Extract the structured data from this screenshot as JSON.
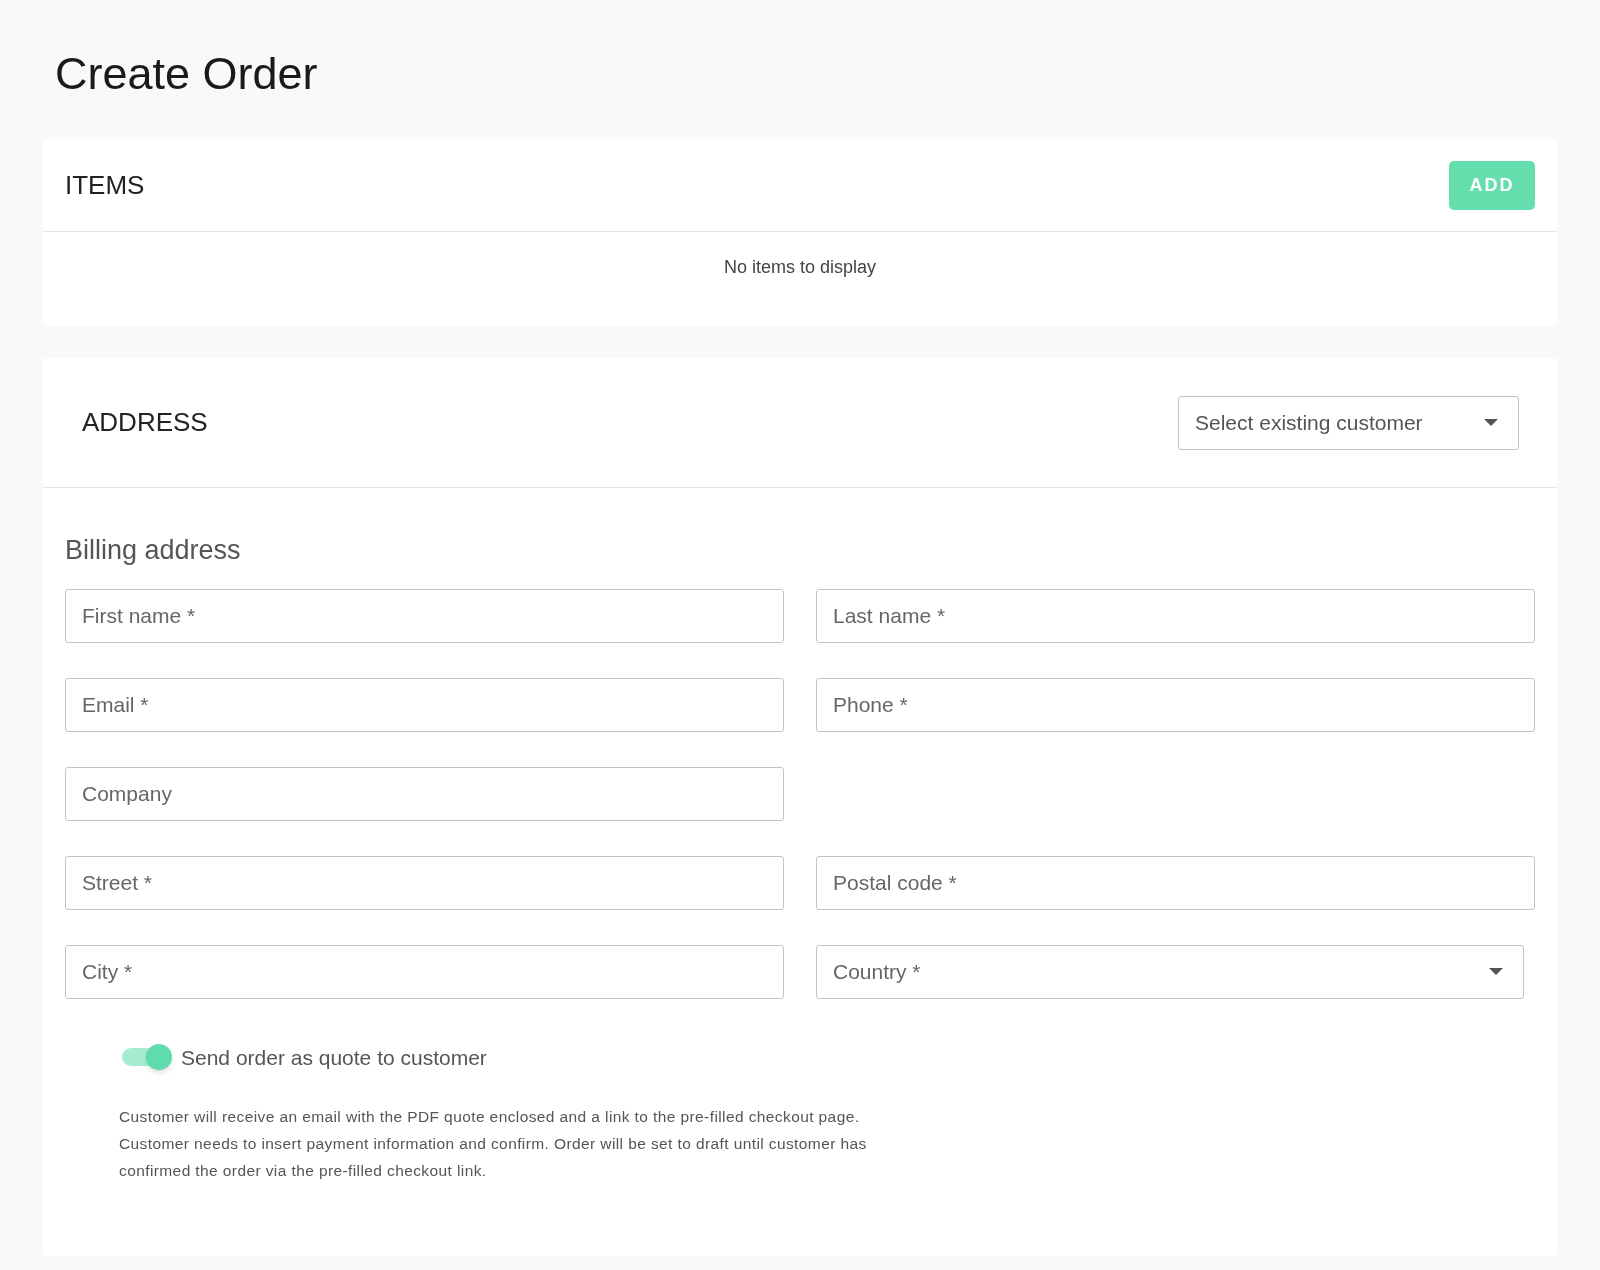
{
  "page": {
    "title": "Create Order"
  },
  "items": {
    "title": "ITEMS",
    "add_button": "ADD",
    "empty_message": "No items to display"
  },
  "address": {
    "title": "ADDRESS",
    "customer_select": {
      "placeholder": "Select existing customer"
    },
    "billing_title": "Billing address",
    "fields": [
      {
        "kind": "input",
        "placeholder": "First name *"
      },
      {
        "kind": "input",
        "placeholder": "Last name *"
      },
      {
        "kind": "input",
        "placeholder": "Email *"
      },
      {
        "kind": "input",
        "placeholder": "Phone *"
      },
      {
        "kind": "input",
        "placeholder": "Company"
      },
      {
        "kind": "empty"
      },
      {
        "kind": "input",
        "placeholder": "Street *"
      },
      {
        "kind": "input",
        "placeholder": "Postal code *"
      },
      {
        "kind": "input",
        "placeholder": "City *"
      },
      {
        "kind": "select",
        "placeholder": "Country *"
      }
    ],
    "quote_toggle": {
      "label": "Send order as quote to customer",
      "on": true
    },
    "note": "Customer will receive an email with the PDF quote enclosed and a link to the pre-filled checkout page. Customer needs to insert payment information and confirm. Order will be set to draft until customer has confirmed the order via the pre-filled checkout link."
  }
}
